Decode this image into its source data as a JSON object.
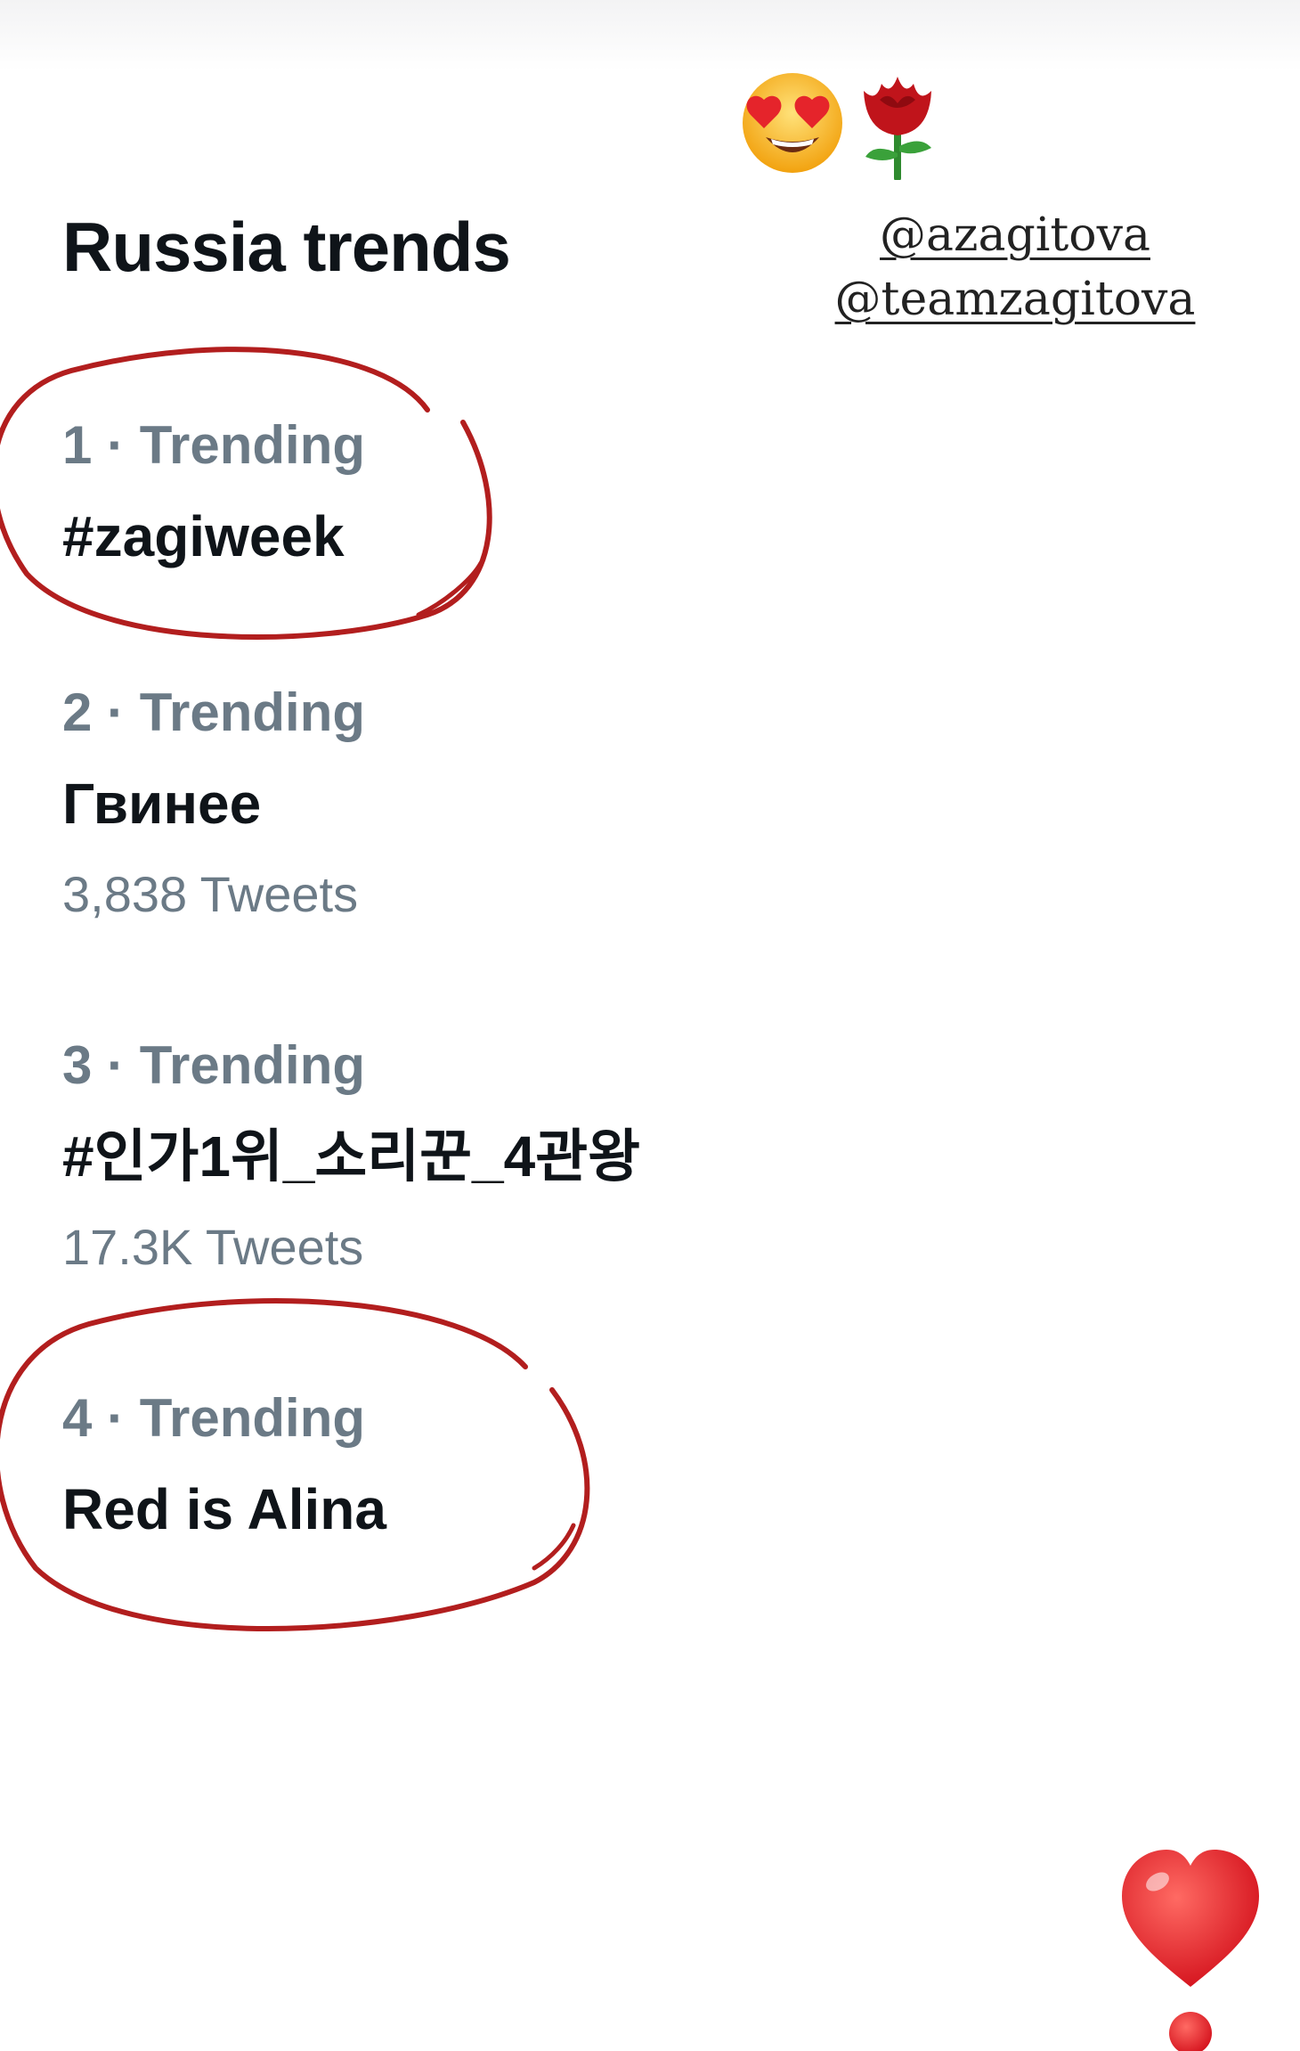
{
  "story": {
    "mentions": [
      "@azagitova",
      "@teamzagitova"
    ],
    "stickers": [
      "heart-eyes-emoji-icon",
      "rose-emoji-icon",
      "red-heart-exclamation-icon"
    ],
    "annotation_color": "#b21e1e"
  },
  "trends_panel": {
    "title": "Russia trends",
    "items": [
      {
        "meta": "1 · Trending",
        "name": "#zagiweek",
        "count": ""
      },
      {
        "meta": "2 · Trending",
        "name": "Гвинее",
        "count": "3,838 Tweets"
      },
      {
        "meta": "3 · Trending",
        "name": "#인가1위_소리꾼_4관왕",
        "count": "17.3K Tweets"
      },
      {
        "meta": "4 · Trending",
        "name": "Red is Alina",
        "count": ""
      }
    ]
  }
}
